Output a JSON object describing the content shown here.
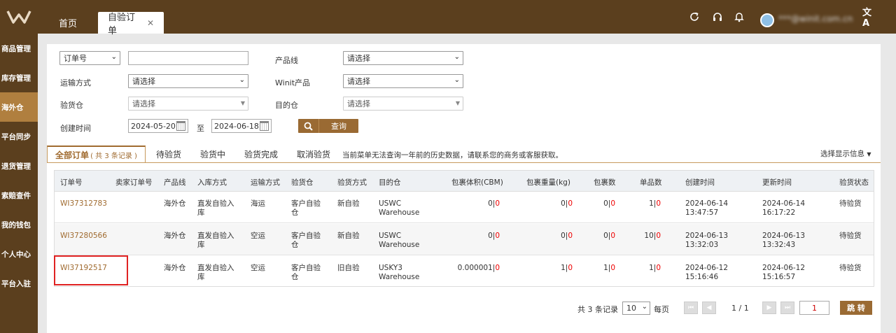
{
  "header": {
    "tabs": [
      {
        "label": "首页"
      },
      {
        "label": "自验订单"
      }
    ],
    "user_email": "***@winit.com.cn"
  },
  "sidebar": {
    "items": [
      {
        "label": "商品管理"
      },
      {
        "label": "库存管理"
      },
      {
        "label": "海外仓"
      },
      {
        "label": "平台同步"
      },
      {
        "label": "退货管理"
      },
      {
        "label": "索赔查件"
      },
      {
        "label": "我的钱包"
      },
      {
        "label": "个人中心"
      },
      {
        "label": "平台入驻"
      }
    ],
    "active_index": 2
  },
  "filters": {
    "order_type_value": "订单号",
    "order_no_value": "",
    "shipping_label": "运输方式",
    "shipping_value": "请选择",
    "warehouse_label": "验货仓",
    "warehouse_value": "请选择",
    "created_label": "创建时间",
    "date_from": "2024-05-20",
    "to_label": "至",
    "date_to": "2024-06-18",
    "product_line_label": "产品线",
    "product_line_value": "请选择",
    "winit_product_label": "Winit产品",
    "winit_product_value": "请选择",
    "destination_label": "目的仓",
    "destination_value": "请选择",
    "search_label": "查询"
  },
  "order_tabs": {
    "all_label": "全部订单",
    "all_count": "( 共 3 条记录 )",
    "items": [
      {
        "label": "待验货"
      },
      {
        "label": "验货中"
      },
      {
        "label": "验货完成"
      },
      {
        "label": "取消验货"
      }
    ],
    "notice": "当前菜单无法查询一年前的历史数据，请联系您的商务或客服获取。",
    "display_label": "选择显示信息"
  },
  "table": {
    "columns": [
      "订单号",
      "卖家订单号",
      "产品线",
      "入库方式",
      "运输方式",
      "验货仓",
      "验货方式",
      "目的仓",
      "包裹体积(CBM)",
      "包裹重量(kg)",
      "包裹数",
      "单品数",
      "创建时间",
      "更新时间",
      "验货状态"
    ],
    "rows": [
      {
        "order_no": "WI37312783",
        "seller_no": "",
        "line": "海外仓",
        "inbound1": "直发自验入",
        "inbound2": "库",
        "ship": "海运",
        "wh1": "客户自验",
        "wh2": "仓",
        "method": "新自验",
        "dest1": "USWC",
        "dest2": "Warehouse",
        "vol": "0",
        "vol_r": "0",
        "wt": "0",
        "wt_r": "0",
        "pkg": "0",
        "pkg_r": "0",
        "items": "1",
        "items_r": "0",
        "created1": "2024-06-14",
        "created2": "13:47:57",
        "updated1": "2024-06-14",
        "updated2": "16:17:22",
        "status": "待验货"
      },
      {
        "order_no": "WI37280566",
        "seller_no": "",
        "line": "海外仓",
        "inbound1": "直发自验入",
        "inbound2": "库",
        "ship": "空运",
        "wh1": "客户自验",
        "wh2": "仓",
        "method": "新自验",
        "dest1": "USWC",
        "dest2": "Warehouse",
        "vol": "0",
        "vol_r": "0",
        "wt": "0",
        "wt_r": "0",
        "pkg": "0",
        "pkg_r": "0",
        "items": "10",
        "items_r": "0",
        "created1": "2024-06-13",
        "created2": "13:32:03",
        "updated1": "2024-06-13",
        "updated2": "13:32:43",
        "status": "待验货"
      },
      {
        "order_no": "WI37192517",
        "seller_no": "",
        "line": "海外仓",
        "inbound1": "直发自验入",
        "inbound2": "库",
        "ship": "空运",
        "wh1": "客户自验",
        "wh2": "仓",
        "method": "旧自验",
        "dest1": "USKY3",
        "dest2": "Warehouse",
        "vol": "0.000001",
        "vol_r": "0",
        "wt": "1",
        "wt_r": "0",
        "pkg": "1",
        "pkg_r": "0",
        "items": "1",
        "items_r": "0",
        "created1": "2024-06-12",
        "created2": "15:16:46",
        "updated1": "2024-06-12",
        "updated2": "15:16:57",
        "status": "待验货"
      }
    ]
  },
  "pagination": {
    "total_label": "共 3 条记录",
    "page_size": "10",
    "per_page_label": "每页",
    "page_info": "1 / 1",
    "jump_value": "1",
    "jump_label": "跳 转"
  },
  "colors": {
    "brand_brown": "#5b3f1e",
    "accent": "#a06b30",
    "active_side": "#b07f3f",
    "highlight_box": "#e02222"
  }
}
